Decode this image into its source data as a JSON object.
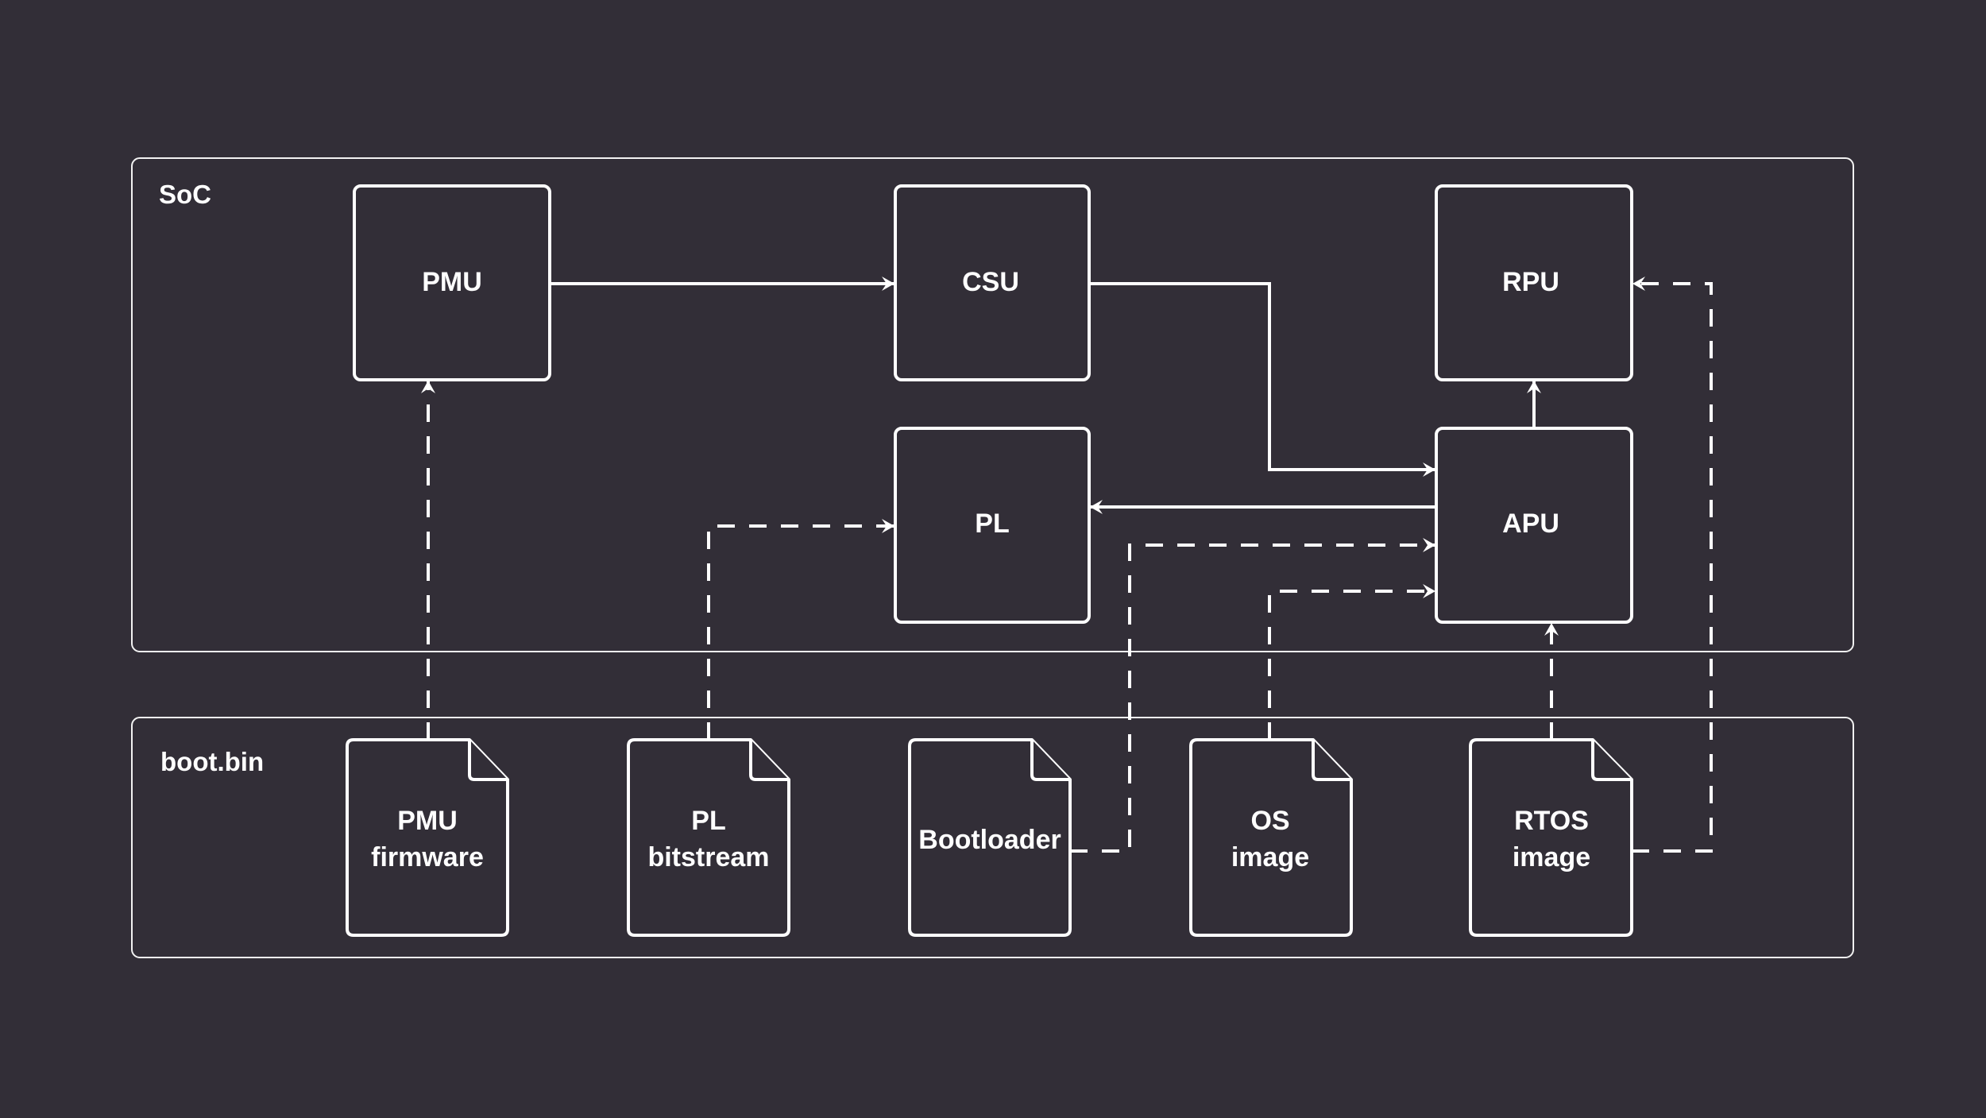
{
  "colors": {
    "background": "#322e37",
    "stroke": "#ffffff",
    "text": "#ffffff"
  },
  "groups": {
    "soc": {
      "label": "SoC"
    },
    "boot": {
      "label": "boot.bin"
    }
  },
  "blocks": {
    "pmu": {
      "label": "PMU"
    },
    "csu": {
      "label": "CSU"
    },
    "rpu": {
      "label": "RPU"
    },
    "pl": {
      "label": "PL"
    },
    "apu": {
      "label": "APU"
    }
  },
  "files": {
    "pmu_fw": {
      "line1": "PMU",
      "line2": "firmware"
    },
    "pl_bit": {
      "line1": "PL",
      "line2": "bitstream"
    },
    "boot": {
      "line1": "Bootloader"
    },
    "os": {
      "line1": "OS",
      "line2": "image"
    },
    "rtos": {
      "line1": "RTOS",
      "line2": "image"
    }
  },
  "edges": [
    {
      "from": "PMU",
      "to": "CSU",
      "style": "solid"
    },
    {
      "from": "CSU",
      "to": "APU",
      "style": "solid"
    },
    {
      "from": "APU",
      "to": "PL",
      "style": "solid"
    },
    {
      "from": "APU",
      "to": "RPU",
      "style": "solid"
    },
    {
      "from": "PMU firmware",
      "to": "PMU",
      "style": "dashed"
    },
    {
      "from": "PL bitstream",
      "to": "PL",
      "style": "dashed"
    },
    {
      "from": "Bootloader",
      "to": "APU",
      "style": "dashed"
    },
    {
      "from": "OS image",
      "to": "APU",
      "style": "dashed"
    },
    {
      "from": "RTOS image",
      "to": "APU",
      "style": "dashed"
    },
    {
      "from": "RTOS image",
      "to": "RPU",
      "style": "dashed"
    }
  ]
}
